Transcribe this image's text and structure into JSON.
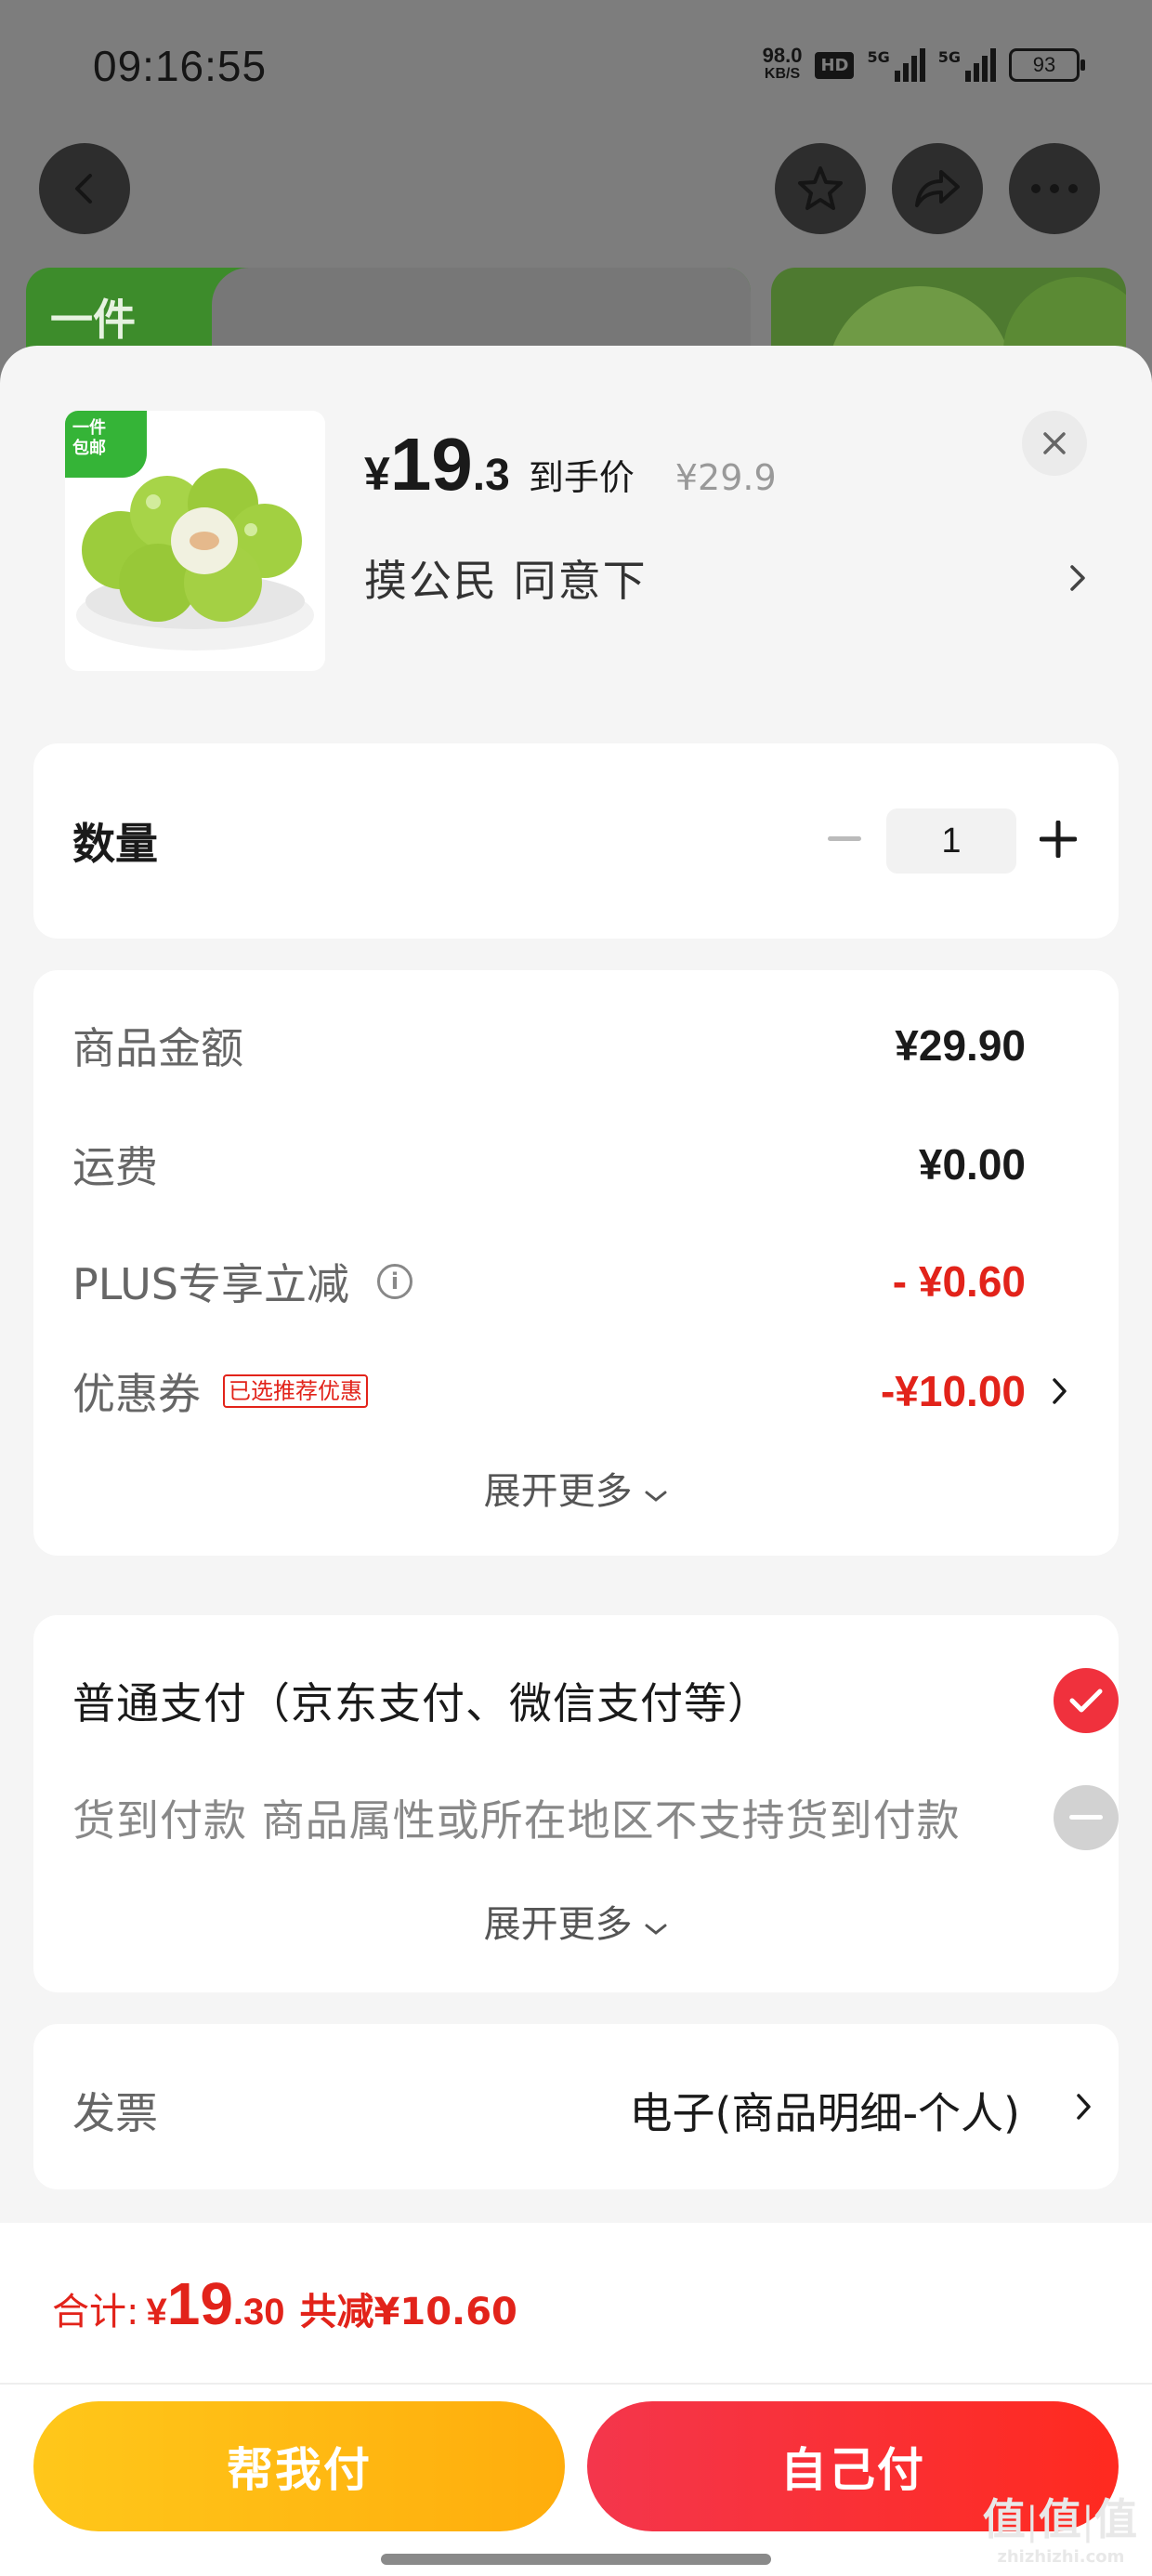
{
  "status_bar": {
    "time": "09:16:55",
    "net_speed": "98.0",
    "net_unit": "KB/S",
    "hd_label": "HD",
    "sig1_label": "5G",
    "sig2_label": "5G",
    "battery": "93"
  },
  "background": {
    "card_tag": "一件"
  },
  "product": {
    "badge_line1": "一件",
    "badge_line2": "包邮",
    "price_symbol": "¥",
    "price_int": "19",
    "price_dec": ".3",
    "price_label": "到手价",
    "original_price": "¥29.9",
    "variant": "摸公民  同意下"
  },
  "quantity": {
    "label": "数量",
    "value": "1"
  },
  "fees": {
    "goods_label": "商品金额",
    "goods_value": "¥29.90",
    "shipping_label": "运费",
    "shipping_value": "¥0.00",
    "plus_label": "PLUS专享立减",
    "plus_value": "- ¥0.60",
    "coupon_label": "优惠券",
    "coupon_tag": "已选推荐优惠",
    "coupon_value": "-¥10.00",
    "expand_label": "展开更多"
  },
  "payment": {
    "normal_label": "普通支付（京东支付、微信支付等）",
    "cod_label": "货到付款 商品属性或所在地区不支持货到付款",
    "expand_label": "展开更多"
  },
  "invoice": {
    "label": "发票",
    "value": "电子(商品明细-个人)"
  },
  "footer": {
    "total_label": "合计:",
    "total_symbol": "¥",
    "total_int": "19",
    "total_dec": ".30",
    "discount": "共减¥10.60",
    "btn_friend": "帮我付",
    "btn_self": "自己付"
  },
  "watermark": {
    "big": "值|值|值",
    "small": "zhizhizhi.com"
  },
  "colors": {
    "accent_red": "#e2231a",
    "check_red": "#f0313d",
    "friend_yellow": "#ffc71a"
  }
}
